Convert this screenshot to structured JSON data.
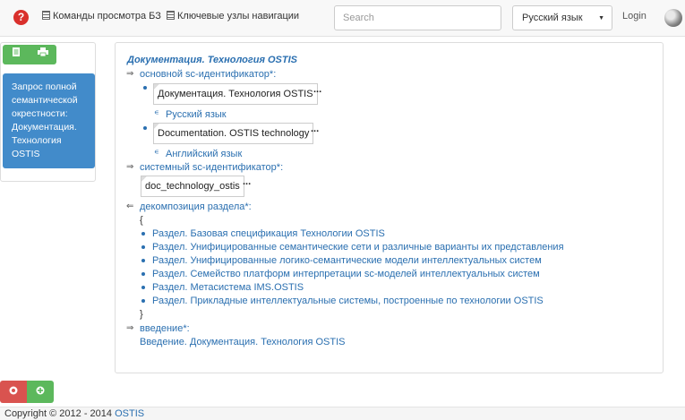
{
  "navbar": {
    "help_icon": "?",
    "items": [
      "Команды просмотра БЗ",
      "Ключевые узлы навигации"
    ],
    "search_placeholder": "Search",
    "language": "Русский язык",
    "login": "Login"
  },
  "left_panel": {
    "query_label": "Запрос полной семантической окрестности: Документация. Технология OSTIS"
  },
  "main": {
    "title": "Документация. Технология OSTIS",
    "rel_main_id": "основной sc-идентификатор*:",
    "ids": [
      {
        "value": "Документация. Технология OSTIS",
        "lang": "Русский язык"
      },
      {
        "value": "Documentation. OSTIS technology",
        "lang": "Английский язык"
      }
    ],
    "rel_sys_id": "системный sc-идентификатор*:",
    "sys_id": "doc_technology_ostis",
    "rel_decomp": "декомпозиция раздела*:",
    "brace_open": "{",
    "brace_close": "}",
    "sections": [
      "Раздел. Базовая спецификация Технологии OSTIS",
      "Раздел. Унифицированные семантические сети и различные варианты их представления",
      "Раздел. Унифицированные логико-семантические модели интеллектуальных систем",
      "Раздел. Семейство платформ интерпретации sc-моделей интеллектуальных систем",
      "Раздел. Метасистема IMS.OSTIS",
      "Раздел. Прикладные интеллектуальные системы, построенные по технологии OSTIS"
    ],
    "rel_intro": "введение*:",
    "intro": "Введение. Документация. Технология OSTIS",
    "dots": "...",
    "elem_sym": "∊",
    "arrow_right": "⇒",
    "arrow_left": "⇐"
  },
  "footer": {
    "copyright": "Copyright © 2012 - 2014",
    "link": "OSTIS"
  }
}
